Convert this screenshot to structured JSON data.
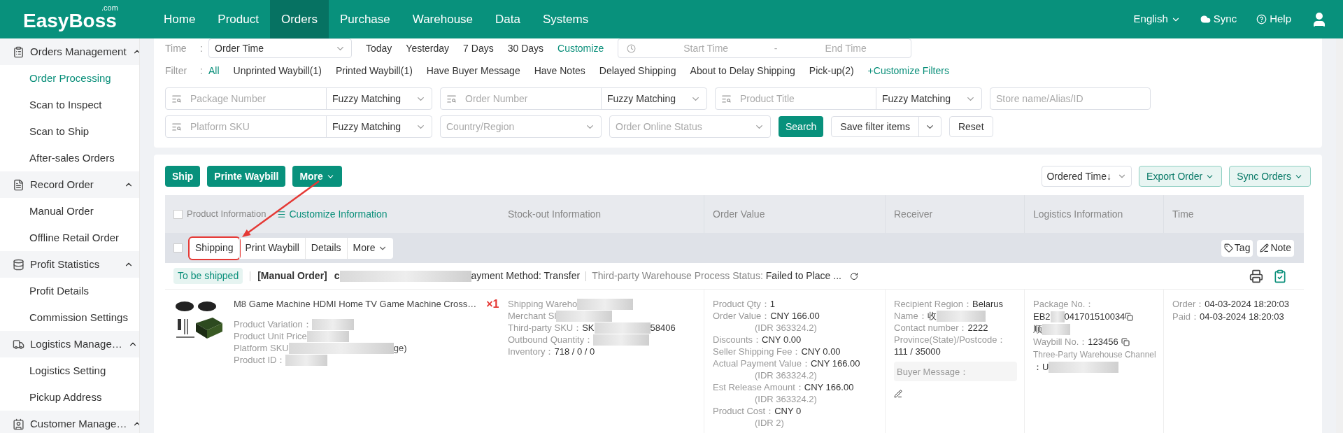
{
  "header": {
    "logo": "EasyBoss",
    "logo_suffix": ".com",
    "nav": [
      {
        "label": "Home",
        "selected": false
      },
      {
        "label": "Product",
        "selected": false
      },
      {
        "label": "Orders",
        "selected": true
      },
      {
        "label": "Purchase",
        "selected": false
      },
      {
        "label": "Warehouse",
        "selected": false
      },
      {
        "label": "Data",
        "selected": false
      },
      {
        "label": "Systems",
        "selected": false
      }
    ],
    "language": "English",
    "sync": "Sync",
    "help": "Help"
  },
  "sidebar": {
    "groups": [
      {
        "title": "Orders Management",
        "expanded": true,
        "items": [
          {
            "label": "Order Processing",
            "selected": true
          },
          {
            "label": "Scan to Inspect",
            "selected": false
          },
          {
            "label": "Scan to Ship",
            "selected": false
          },
          {
            "label": "After-sales Orders",
            "selected": false
          }
        ]
      },
      {
        "title": "Record Order",
        "expanded": true,
        "items": [
          {
            "label": "Manual Order",
            "selected": false
          },
          {
            "label": "Offline Retail Order",
            "selected": false
          }
        ]
      },
      {
        "title": "Profit Statistics",
        "expanded": true,
        "items": [
          {
            "label": "Profit Details",
            "selected": false
          },
          {
            "label": "Commission Settings",
            "selected": false
          }
        ]
      },
      {
        "title": "Logistics Manage…",
        "expanded": true,
        "items": [
          {
            "label": "Logistics Setting",
            "selected": false
          },
          {
            "label": "Pickup Address",
            "selected": false
          }
        ]
      },
      {
        "title": "Customer Manage…",
        "expanded": true
      }
    ]
  },
  "filters": {
    "time": {
      "label": "Time",
      "colon": ":",
      "select": "Order Time",
      "quick": [
        {
          "label": "Today",
          "kind": "option"
        },
        {
          "label": "Yesterday",
          "kind": "option"
        },
        {
          "label": "7 Days",
          "kind": "option"
        },
        {
          "label": "30 Days",
          "kind": "option"
        },
        {
          "label": "Customize",
          "kind": "link"
        }
      ],
      "start_placeholder": "Start Time",
      "separator": "-",
      "end_placeholder": "End Time"
    },
    "filter": {
      "label": "Filter",
      "colon": ":",
      "options": [
        {
          "label": "All",
          "selected": true
        },
        {
          "label": "Unprinted Waybill(1)",
          "selected": false
        },
        {
          "label": "Printed Waybill(1)",
          "selected": false
        },
        {
          "label": "Have Buyer Message",
          "selected": false
        },
        {
          "label": "Have Notes",
          "selected": false
        },
        {
          "label": "Delayed Shipping",
          "selected": false
        },
        {
          "label": "About to Delay Shipping",
          "selected": false
        },
        {
          "label": "Pick-up(2)",
          "selected": false
        }
      ],
      "add_link": "+Customize Filters"
    },
    "row1": [
      {
        "kind": "search",
        "placeholder": "Package Number",
        "match": "Fuzzy Matching"
      },
      {
        "kind": "search",
        "placeholder": "Order Number",
        "match": "Fuzzy Matching"
      },
      {
        "kind": "search",
        "placeholder": "Product Title",
        "match": "Fuzzy Matching"
      },
      {
        "kind": "text",
        "placeholder": "Store name/Alias/ID"
      }
    ],
    "row2": [
      {
        "kind": "search",
        "placeholder": "Platform SKU",
        "match": "Fuzzy Matching"
      },
      {
        "kind": "select",
        "placeholder": "Country/Region"
      },
      {
        "kind": "select",
        "placeholder": "Order Online Status"
      }
    ],
    "search_button": "Search",
    "save_button": "Save filter items",
    "reset_button": "Reset"
  },
  "toolbar": {
    "ship": "Ship",
    "print": "Printe Waybill",
    "more": "More",
    "sort": "Ordered Time↓",
    "export": "Export Order",
    "sync_orders": "Sync Orders"
  },
  "table": {
    "columns": [
      "Product Information",
      "Stock-out Information",
      "Order Value",
      "Receiver",
      "Logistics Information",
      "Time"
    ],
    "customize": "Customize Information",
    "select_all_checked": false
  },
  "order": {
    "checked": false,
    "actions": [
      {
        "label": "Shipping",
        "highlighted": true,
        "dropdown": false
      },
      {
        "label": "Print Waybill",
        "highlighted": false,
        "dropdown": false
      },
      {
        "label": "Details",
        "highlighted": false,
        "dropdown": false
      },
      {
        "label": "More",
        "highlighted": false,
        "dropdown": true
      }
    ],
    "tag": "Tag",
    "note": "Note",
    "status": "To be shipped",
    "type": "[Manual Order]",
    "order_prefix": "c",
    "payment": "ayment Method: Transfer",
    "process_label": "Third-party Warehouse Process Status:",
    "process_value": "Failed to Place ...",
    "product": {
      "title": "M8 Game Machine HDMI Home TV Game Machine Cross…",
      "qty": "×1",
      "details": [
        {
          "label": "Product Variation：",
          "blurred": true
        },
        {
          "label": "Product Unit Price",
          "blurred": true
        },
        {
          "label": "Platform SKU",
          "blurred": true,
          "tail": "ge)"
        },
        {
          "label": "Product ID：",
          "blurred": true
        }
      ]
    },
    "stock": [
      {
        "label": "Shipping Wareho",
        "blurred": true
      },
      {
        "label": "Merchant Sl",
        "blurred": true
      },
      {
        "label": "Third-party SKU：",
        "value": "SK",
        "blurred": true,
        "tail": "58406"
      },
      {
        "label": "Outbound Quantity：",
        "blurred": true
      },
      {
        "label": "Inventory：",
        "value": "718 / 0 / 0",
        "blurred": false
      }
    ],
    "value": [
      {
        "label": "Product Qty：",
        "value": "1"
      },
      {
        "label": "Order Value：",
        "value": "CNY 166.00",
        "sub": "(IDR 363324.2)"
      },
      {
        "label": "Discounts：",
        "value": "CNY 0.00"
      },
      {
        "label": "Seller Shipping Fee：",
        "value": "CNY 0.00"
      },
      {
        "label": "Actual Payment Value：",
        "value": "CNY 166.00",
        "sub": "(IDR 363324.2)"
      },
      {
        "label": "Est Release Amount：",
        "value": "CNY 166.00",
        "sub": "(IDR 363324.2)"
      },
      {
        "label": "Product Cost：",
        "value": "CNY 0",
        "sub": "(IDR 2)"
      }
    ],
    "receiver": {
      "region_label": "Recipient Region：",
      "region": "Belarus",
      "name_label": "Name：",
      "name": "收",
      "contact_label": "Contact number：",
      "contact": "2222",
      "postcode_label": "Province(State)/Postcode：",
      "postcode": "111 / 35000",
      "message_label": "Buyer Message："
    },
    "logistics": {
      "package_label": "Package No.：",
      "package_head": "EB2",
      "package_tail": "041701510034",
      "carrier": "顺",
      "waybill_label": "Waybill No.：",
      "waybill": "123456",
      "channel_label": "Three-Party Warehouse Channel",
      "channel_value": "：U"
    },
    "time": [
      {
        "label": "Order：",
        "value": "04-03-2024 18:20:03"
      },
      {
        "label": "Paid：",
        "value": "04-03-2024 18:20:03"
      }
    ]
  }
}
